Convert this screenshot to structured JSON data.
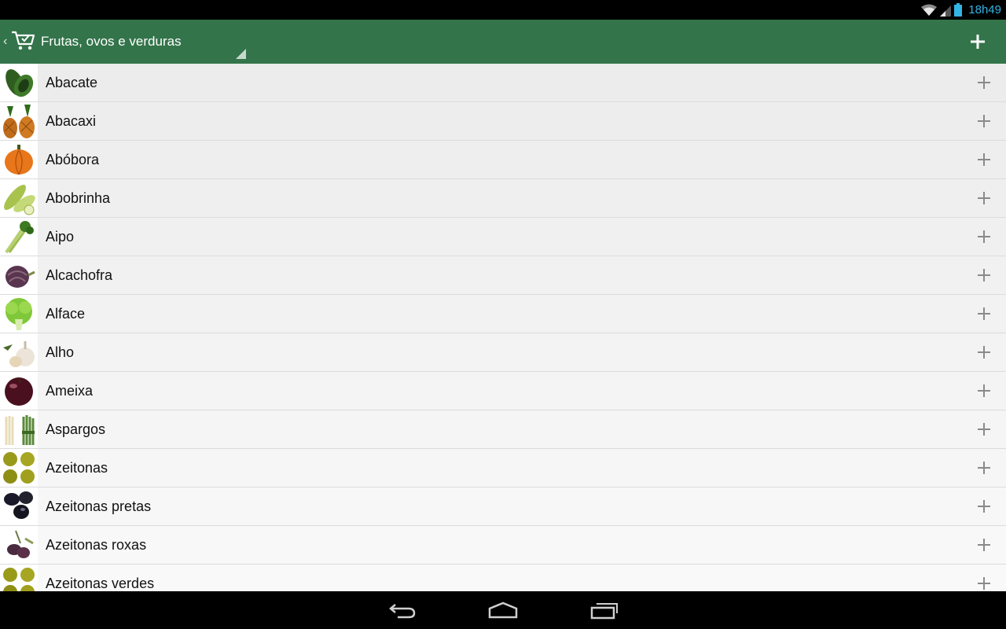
{
  "status_bar": {
    "time": "18h49",
    "icons": [
      "wifi-icon",
      "signal-icon",
      "battery-icon"
    ],
    "accent_color": "#33b5e5"
  },
  "action_bar": {
    "title": "Frutas, ovos e verduras",
    "background_color": "#33744a",
    "icons": [
      "back-caret-icon",
      "shopping-cart-icon",
      "spinner-dropdown-icon",
      "plus-icon"
    ]
  },
  "items": [
    {
      "label": "Abacate",
      "icon": "avocado-icon"
    },
    {
      "label": "Abacaxi",
      "icon": "pineapple-icon"
    },
    {
      "label": "Abóbora",
      "icon": "pumpkin-icon"
    },
    {
      "label": "Abobrinha",
      "icon": "zucchini-icon"
    },
    {
      "label": "Aipo",
      "icon": "celery-icon"
    },
    {
      "label": "Alcachofra",
      "icon": "artichoke-icon"
    },
    {
      "label": "Alface",
      "icon": "lettuce-icon"
    },
    {
      "label": "Alho",
      "icon": "garlic-icon"
    },
    {
      "label": "Ameixa",
      "icon": "plum-icon"
    },
    {
      "label": "Aspargos",
      "icon": "asparagus-icon"
    },
    {
      "label": "Azeitonas",
      "icon": "green-olives-icon"
    },
    {
      "label": "Azeitonas pretas",
      "icon": "black-olives-icon"
    },
    {
      "label": "Azeitonas roxas",
      "icon": "purple-olives-icon"
    },
    {
      "label": "Azeitonas verdes",
      "icon": "green-olives-icon"
    }
  ],
  "nav_bar": {
    "buttons": [
      "back-icon",
      "home-icon",
      "recent-apps-icon"
    ]
  }
}
